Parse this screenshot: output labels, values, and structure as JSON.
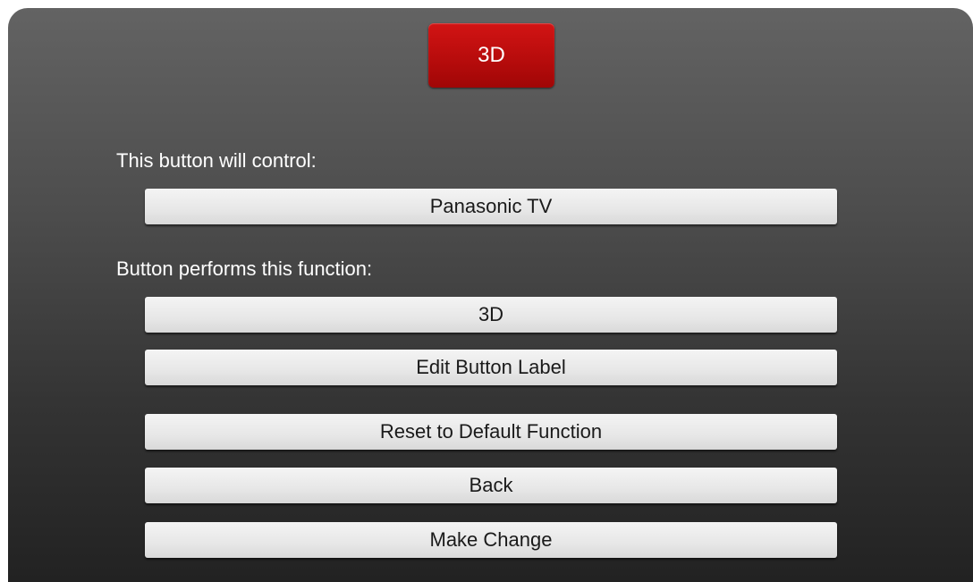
{
  "header": {
    "button_label": "3D",
    "button_color": "#b80c0c"
  },
  "device_section": {
    "label": "This button will control:",
    "device_button_label": "Panasonic TV"
  },
  "function_section": {
    "label": "Button performs this function:",
    "function_button_label": "3D"
  },
  "actions": {
    "edit_label": "Edit Button Label",
    "reset_label": "Reset to Default Function",
    "back_label": "Back",
    "make_change_label": "Make Change"
  }
}
